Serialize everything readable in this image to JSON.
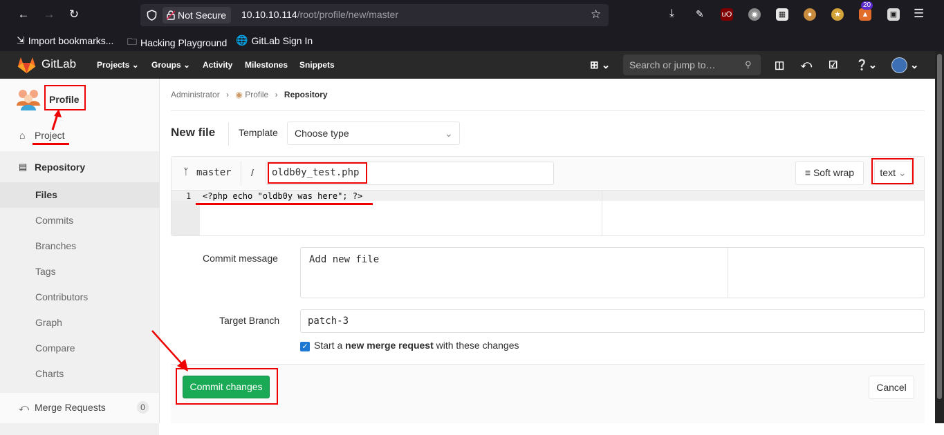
{
  "browser": {
    "security_label": "Not Secure",
    "url_host": "10.10.10.114",
    "url_path": "/root/profile/new/master",
    "bookmarks": [
      "Import bookmarks...",
      "Hacking Playground",
      "GitLab Sign In"
    ],
    "ext_badge": "20"
  },
  "gitlab": {
    "brand": "GitLab",
    "nav": [
      "Projects",
      "Groups",
      "Activity",
      "Milestones",
      "Snippets"
    ],
    "search_placeholder": "Search or jump to…"
  },
  "sidebar": {
    "project_name": "Profile",
    "project_link": "Project",
    "section": "Repository",
    "items": [
      "Files",
      "Commits",
      "Branches",
      "Tags",
      "Contributors",
      "Graph",
      "Compare",
      "Charts"
    ],
    "merge_requests": "Merge Requests",
    "merge_requests_count": "0"
  },
  "breadcrumb": [
    "Administrator",
    "Profile",
    "Repository"
  ],
  "editor": {
    "heading": "New file",
    "template_label": "Template",
    "template_select": "Choose type",
    "branch": "master",
    "path_sep": "/",
    "file_name": "oldb0y_test.php",
    "soft_wrap": "Soft wrap",
    "mode": "text",
    "line_number": "1",
    "code": "<?php echo \"oldb0y was here\"; ?>"
  },
  "commit": {
    "message_label": "Commit message",
    "message": "Add new file",
    "branch_label": "Target Branch",
    "branch": "patch-3",
    "mr_prefix": "Start a ",
    "mr_bold": "new merge request",
    "mr_suffix": " with these changes",
    "mr_checked": true,
    "commit_button": "Commit changes",
    "cancel_button": "Cancel"
  },
  "colors": {
    "annotation_red": "#ee0000",
    "gitlab_green": "#1aaa55",
    "header_bg": "#292929"
  }
}
